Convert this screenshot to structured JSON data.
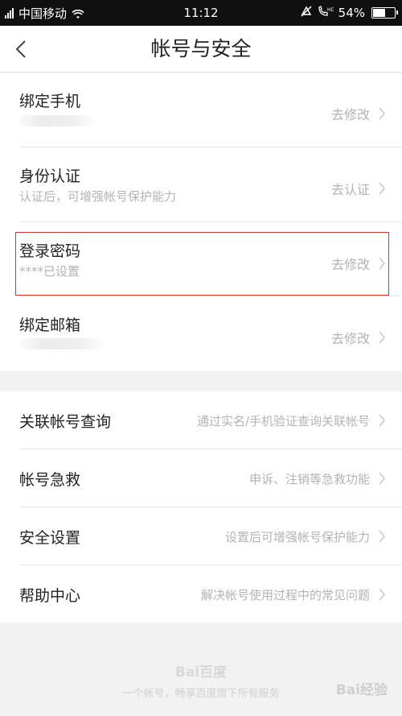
{
  "status_bar": {
    "carrier": "中国移动",
    "time": "11:12",
    "battery": "54%",
    "battery_level": 0.54
  },
  "header": {
    "title": "帐号与安全",
    "back_icon": "chevron-left-icon"
  },
  "section1": [
    {
      "title": "绑定手机",
      "subtitle": "",
      "action": "去修改"
    },
    {
      "title": "身份认证",
      "subtitle": "认证后，可增强帐号保护能力",
      "action": "去认证"
    },
    {
      "title": "登录密码",
      "subtitle": "****已设置",
      "action": "去修改"
    },
    {
      "title": "绑定邮箱",
      "subtitle": "",
      "action": "去修改"
    }
  ],
  "section2": [
    {
      "title": "关联帐号查询",
      "desc": "通过实名/手机验证查询关联帐号"
    },
    {
      "title": "帐号急救",
      "desc": "申诉、注销等急救功能"
    },
    {
      "title": "安全设置",
      "desc": "设置后可增强帐号保护能力"
    },
    {
      "title": "帮助中心",
      "desc": "解决帐号使用过程中的常见问题"
    }
  ],
  "footer": {
    "logo": "Bai百度",
    "text": "一个帐号，畅享百度旗下所有服务"
  },
  "watermark": "Bai经验",
  "colors": {
    "highlight": "#d6352e",
    "secondary_text": "#b3b3b3"
  }
}
